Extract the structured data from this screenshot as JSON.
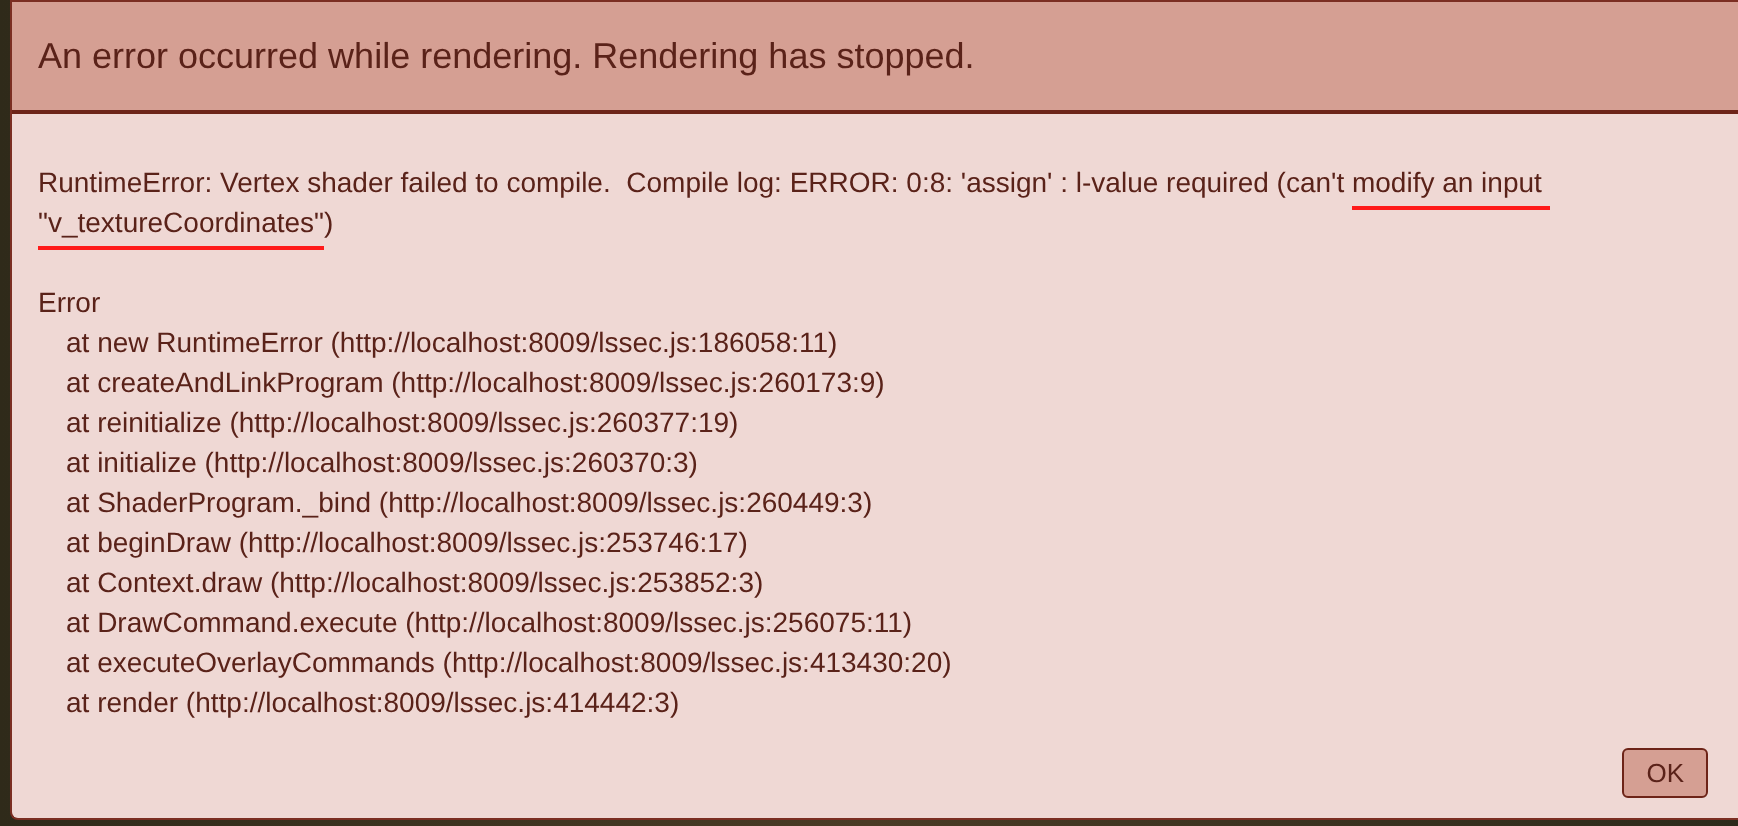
{
  "dialog": {
    "title": "An error occurred while rendering. Rendering has stopped.",
    "message": [
      {
        "text": "RuntimeError: Vertex shader failed to compile.  Compile log: ERROR: 0:8: 'assign' : l-value required (can't ",
        "underlined": false
      },
      {
        "text": "modify an input",
        "underlined": true
      },
      {
        "text": " \"v_textureCoordinates\"",
        "underlined": true
      },
      {
        "text": ")",
        "underlined": false
      }
    ],
    "stack": {
      "title": "Error",
      "frames": [
        "at new RuntimeError (http://localhost:8009/lssec.js:186058:11)",
        "at createAndLinkProgram (http://localhost:8009/lssec.js:260173:9)",
        "at reinitialize (http://localhost:8009/lssec.js:260377:19)",
        "at initialize (http://localhost:8009/lssec.js:260370:3)",
        "at ShaderProgram._bind (http://localhost:8009/lssec.js:260449:3)",
        "at beginDraw (http://localhost:8009/lssec.js:253746:17)",
        "at Context.draw (http://localhost:8009/lssec.js:253852:3)",
        "at DrawCommand.execute (http://localhost:8009/lssec.js:256075:11)",
        "at executeOverlayCommands (http://localhost:8009/lssec.js:413430:20)",
        "at render (http://localhost:8009/lssec.js:414442:3)"
      ]
    },
    "buttons": [
      "OK"
    ]
  }
}
